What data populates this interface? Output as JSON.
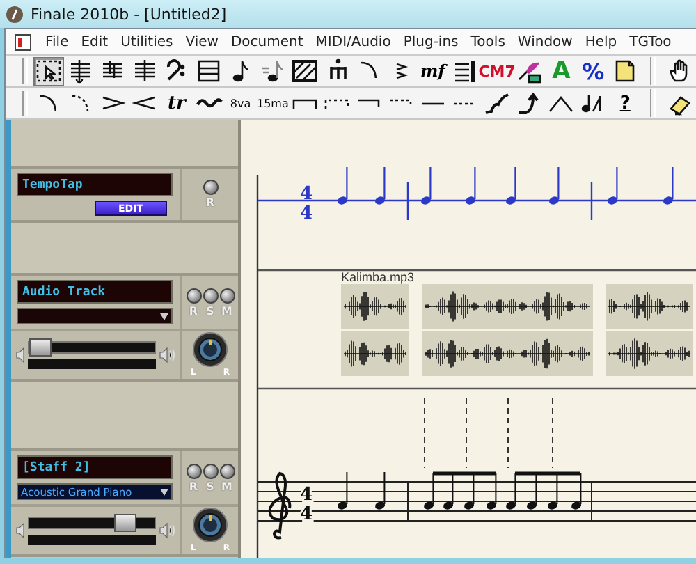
{
  "window": {
    "title": "Finale 2010b - [Untitled2]"
  },
  "menu": [
    "File",
    "Edit",
    "Utilities",
    "View",
    "Document",
    "MIDI/Audio",
    "Plug-ins",
    "Tools",
    "Window",
    "Help",
    "TGToo"
  ],
  "toolbar_main": [
    {
      "kind": "selection",
      "selected": true
    },
    {
      "kind": "staff",
      "selected": false
    },
    {
      "kind": "key-signature",
      "selected": false
    },
    {
      "kind": "time-signature",
      "selected": false
    },
    {
      "kind": "clef",
      "selected": false
    },
    {
      "kind": "measure",
      "selected": false
    },
    {
      "kind": "simple-entry",
      "selected": false
    },
    {
      "kind": "speedy-entry",
      "selected": false
    },
    {
      "kind": "hyperscore",
      "selected": false
    },
    {
      "kind": "tuplet",
      "selected": false
    },
    {
      "kind": "smart-shape",
      "selected": false
    },
    {
      "kind": "articulation",
      "selected": false
    },
    {
      "kind": "expression",
      "label": "mf",
      "selected": false
    },
    {
      "kind": "repeat",
      "selected": false
    },
    {
      "kind": "chord",
      "label": "CM7",
      "selected": false
    },
    {
      "kind": "lyrics",
      "selected": false
    },
    {
      "kind": "text",
      "label": "A",
      "selected": false
    },
    {
      "kind": "resize",
      "label": "%",
      "selected": false
    },
    {
      "kind": "page-layout",
      "selected": false
    },
    {
      "kind": "hand",
      "selected": false
    }
  ],
  "toolbar_shapes": [
    {
      "kind": "slur"
    },
    {
      "kind": "dashed-slur"
    },
    {
      "kind": "decrescendo"
    },
    {
      "kind": "crescendo"
    },
    {
      "kind": "trill",
      "label": "tr"
    },
    {
      "kind": "trill-extension"
    },
    {
      "kind": "ottava",
      "label": "8va"
    },
    {
      "kind": "quindicesima",
      "label": "15ma"
    },
    {
      "kind": "bracket"
    },
    {
      "kind": "dashed-bracket"
    },
    {
      "kind": "bracket-down"
    },
    {
      "kind": "dashed-bracket-down"
    },
    {
      "kind": "line"
    },
    {
      "kind": "dashed-line"
    },
    {
      "kind": "glissando"
    },
    {
      "kind": "bend"
    },
    {
      "kind": "bend-hat"
    },
    {
      "kind": "custom-line"
    },
    {
      "kind": "help",
      "label": "?"
    },
    {
      "kind": "eraser"
    }
  ],
  "tracks": [
    {
      "kind": "tempo",
      "name": "TempoTap",
      "button": "EDIT",
      "toggles": [
        "R"
      ]
    },
    {
      "kind": "audio",
      "name": "Audio Track",
      "toggles": [
        "R",
        "S",
        "M"
      ],
      "level": 0.08,
      "pan": [
        "L",
        "R"
      ]
    },
    {
      "kind": "staff",
      "name": "[Staff 2]",
      "instrument": "Acoustic Grand Piano",
      "toggles": [
        "R",
        "S",
        "M"
      ],
      "level": 0.75,
      "pan": [
        "L",
        "R"
      ]
    }
  ],
  "score": {
    "tempo_time_signature": [
      "4",
      "4"
    ],
    "audio_clip": "Kalimba.mp3",
    "staff_time_signature": [
      "4",
      "4"
    ]
  }
}
